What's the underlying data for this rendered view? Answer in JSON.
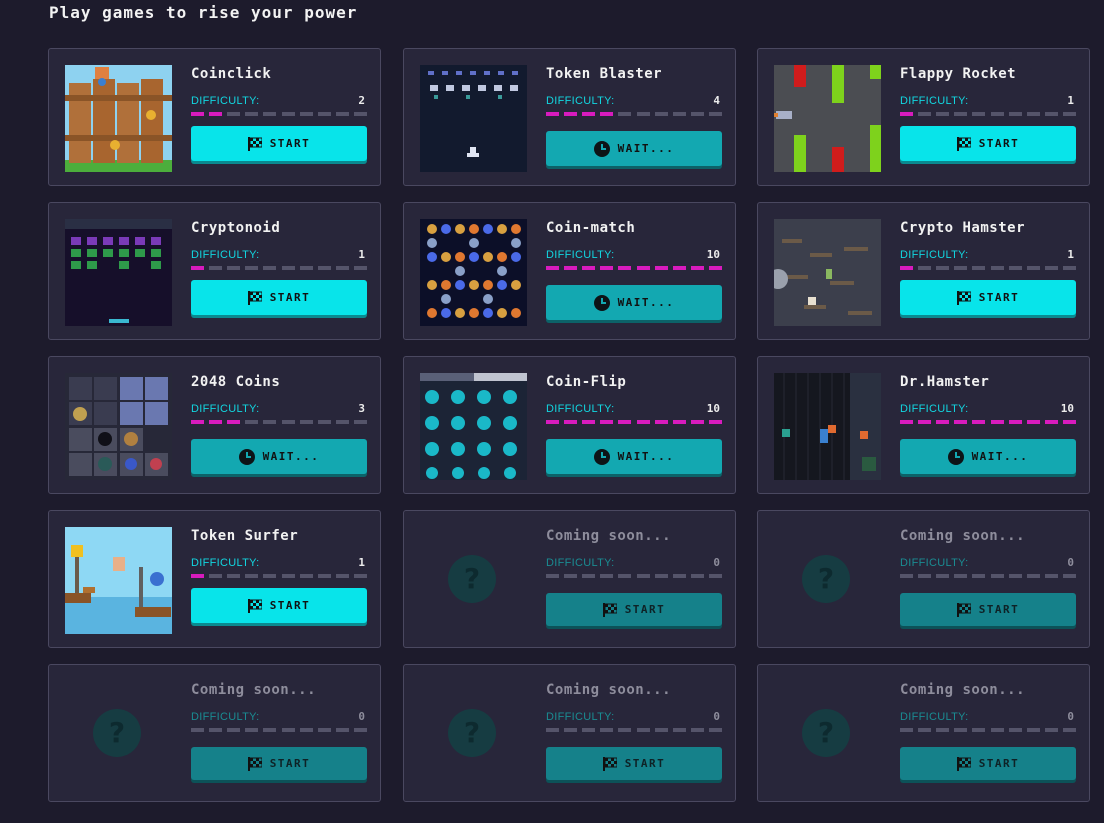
{
  "page": {
    "title": "Play games to rise your power"
  },
  "labels": {
    "difficulty": "DIFFICULTY:",
    "start": "START",
    "wait": "WAIT..."
  },
  "colors": {
    "accent": "#08e4ea",
    "difficulty_fill": "#d81bbe",
    "background": "#1d1b2c",
    "card": "#28263a"
  },
  "games": [
    {
      "name": "Coinclick",
      "difficulty": 2,
      "button": "START",
      "state": "start",
      "thumb": "coinclick"
    },
    {
      "name": "Token Blaster",
      "difficulty": 4,
      "button": "WAIT...",
      "state": "wait",
      "thumb": "blaster"
    },
    {
      "name": "Flappy Rocket",
      "difficulty": 1,
      "button": "START",
      "state": "start",
      "thumb": "flappy"
    },
    {
      "name": "Cryptonoid",
      "difficulty": 1,
      "button": "START",
      "state": "start",
      "thumb": "cryptonoid"
    },
    {
      "name": "Coin-match",
      "difficulty": 10,
      "button": "WAIT...",
      "state": "wait",
      "thumb": "coinmatch"
    },
    {
      "name": "Crypto Hamster",
      "difficulty": 1,
      "button": "START",
      "state": "start",
      "thumb": "hamster"
    },
    {
      "name": "2048 Coins",
      "difficulty": 3,
      "button": "WAIT...",
      "state": "wait",
      "thumb": "coins2048"
    },
    {
      "name": "Coin-Flip",
      "difficulty": 10,
      "button": "WAIT...",
      "state": "wait",
      "thumb": "coinflip"
    },
    {
      "name": "Dr.Hamster",
      "difficulty": 10,
      "button": "WAIT...",
      "state": "wait",
      "thumb": "drhamster"
    },
    {
      "name": "Token Surfer",
      "difficulty": 1,
      "button": "START",
      "state": "start",
      "thumb": "surfer"
    },
    {
      "name": "Coming soon...",
      "difficulty": 0,
      "button": "START",
      "state": "soon",
      "thumb": "placeholder"
    },
    {
      "name": "Coming soon...",
      "difficulty": 0,
      "button": "START",
      "state": "soon",
      "thumb": "placeholder"
    },
    {
      "name": "Coming soon...",
      "difficulty": 0,
      "button": "START",
      "state": "soon",
      "thumb": "placeholder"
    },
    {
      "name": "Coming soon...",
      "difficulty": 0,
      "button": "START",
      "state": "soon",
      "thumb": "placeholder"
    },
    {
      "name": "Coming soon...",
      "difficulty": 0,
      "button": "START",
      "state": "soon",
      "thumb": "placeholder"
    }
  ]
}
